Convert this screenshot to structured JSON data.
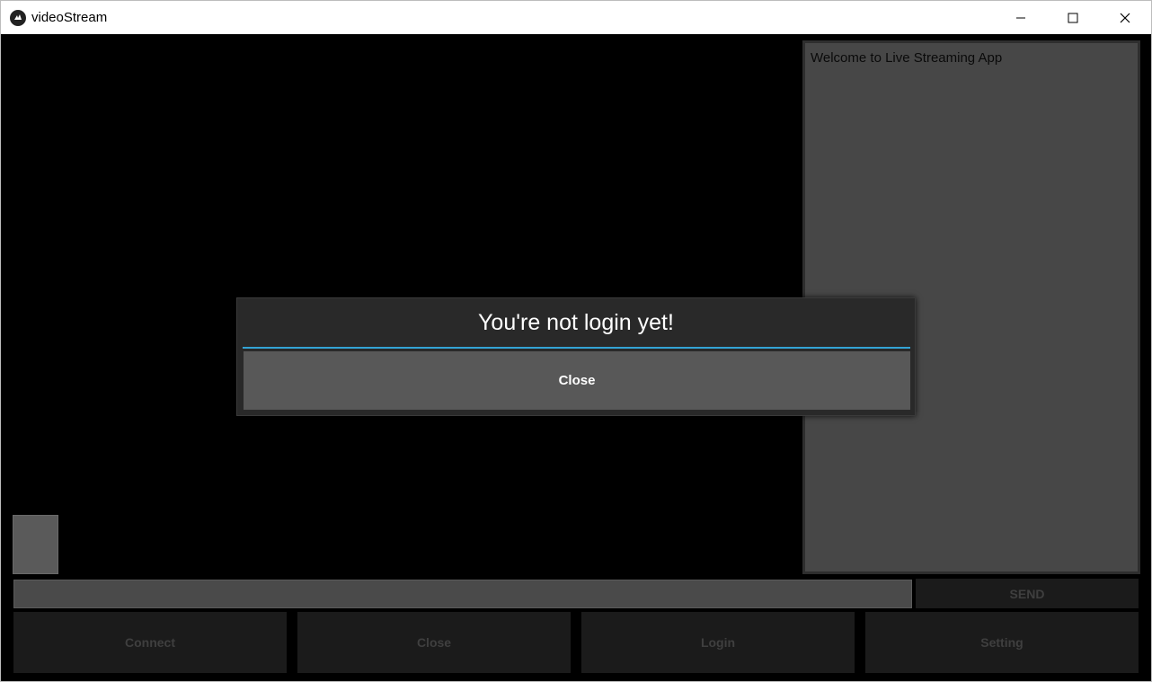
{
  "window": {
    "title": "videoStream",
    "app_icon": "kivy-logo-icon",
    "controls": [
      "minimize-icon",
      "maximize-icon",
      "close-icon"
    ]
  },
  "chat": {
    "welcome_text": "Welcome to Live Streaming App"
  },
  "message": {
    "value": "",
    "placeholder": "",
    "send_label": "SEND"
  },
  "toolbar": {
    "connect_label": "Connect",
    "close_label": "Close",
    "login_label": "Login",
    "setting_label": "Setting"
  },
  "dialog": {
    "title": "You're not login yet!",
    "close_label": "Close"
  },
  "colors": {
    "accent": "#33a3d5",
    "dialog_bg": "#292929",
    "button_bg": "#585858",
    "disabled_text": "#3f3f3f"
  }
}
